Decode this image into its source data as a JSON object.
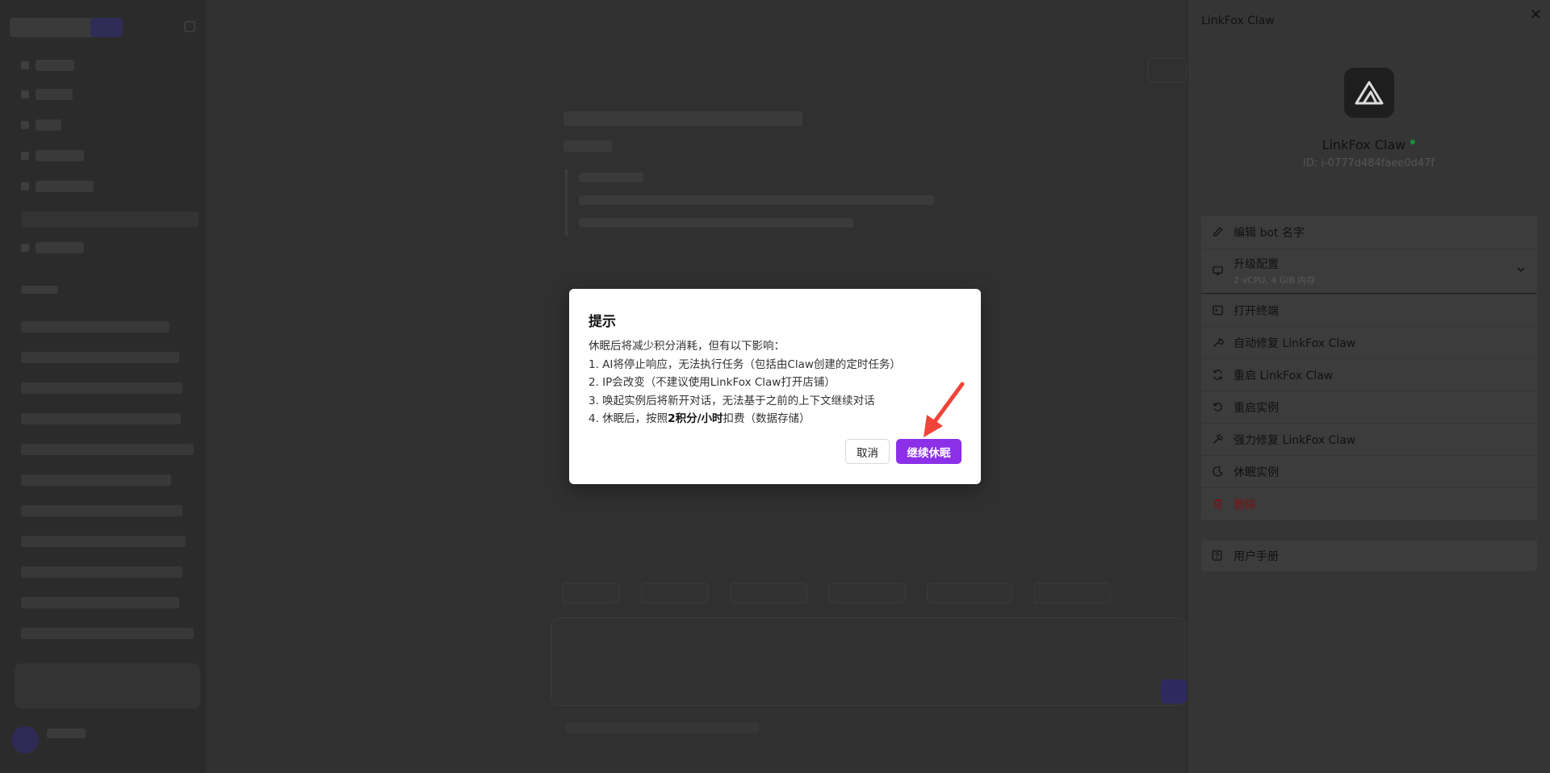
{
  "panel": {
    "title": "LinkFox Claw",
    "close_glyph": "✕",
    "bot_name": "LinkFox Claw",
    "bot_id": "ID: i-0777d484faee0d47f",
    "menu": [
      {
        "label": "编辑 bot 名字",
        "icon": "pencil-icon"
      },
      {
        "label": "升级配置",
        "sublabel": "2 vCPU, 4 GiB 内存",
        "icon": "monitor-icon"
      },
      {
        "label": "打开终端",
        "icon": "terminal-icon"
      },
      {
        "label": "自动修复 LinkFox Claw",
        "icon": "wrench-icon"
      },
      {
        "label": "重启 LinkFox Claw",
        "icon": "refresh-icon"
      },
      {
        "label": "重启实例",
        "icon": "rotate-icon"
      },
      {
        "label": "强力修复 LinkFox Claw",
        "icon": "hammer-icon"
      },
      {
        "label": "休眠实例",
        "icon": "moon-icon"
      },
      {
        "label": "删除",
        "icon": "trash-icon"
      }
    ],
    "manual_label": "用户手册"
  },
  "modal": {
    "title": "提示",
    "intro": "休眠后将减少积分消耗，但有以下影响：",
    "items": [
      "1. AI将停止响应，无法执行任务（包括由Claw创建的定时任务）",
      "2. IP会改变（不建议使用LinkFox Claw打开店铺）",
      "3. 唤起实例后将新开对话，无法基于之前的上下文继续对话"
    ],
    "item4_prefix": "4. 休眠后，按照",
    "item4_bold": "2积分/小时",
    "item4_suffix": "扣费（数据存储）",
    "cancel_label": "取消",
    "confirm_label": "继续休眠"
  },
  "colors": {
    "accent": "#8b2fe8",
    "arrow": "#f04438",
    "danger": "#e53935",
    "online": "#22c55e"
  }
}
